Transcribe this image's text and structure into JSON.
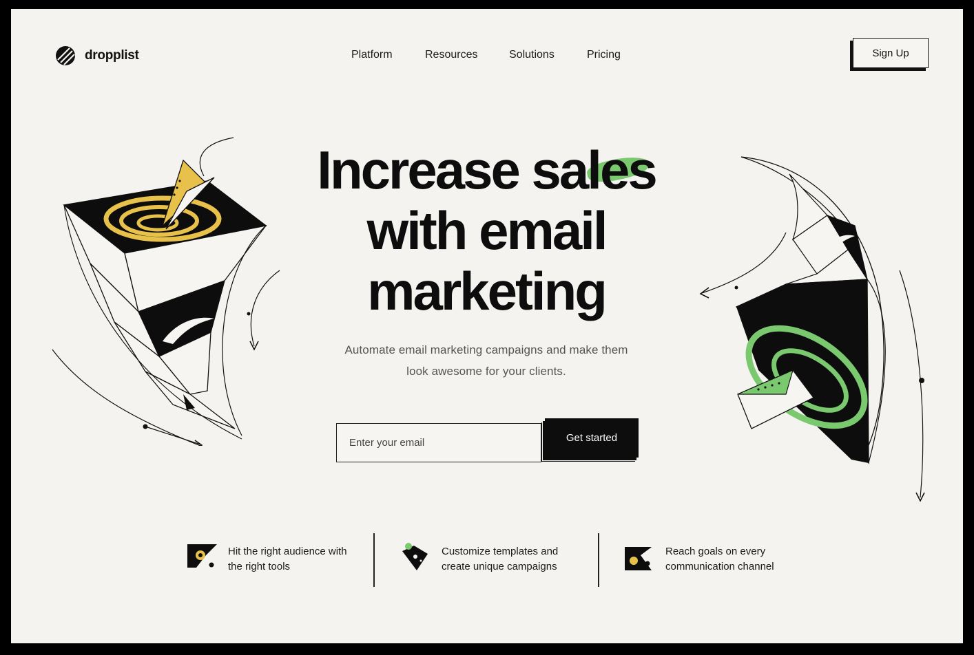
{
  "brand": {
    "name": "dropplist",
    "icon": "dropplist-logo-icon"
  },
  "nav": {
    "items": [
      {
        "label": "Platform"
      },
      {
        "label": "Resources"
      },
      {
        "label": "Solutions"
      },
      {
        "label": "Pricing"
      }
    ],
    "signup_label": "Sign Up"
  },
  "hero": {
    "line1_a": "Increase s",
    "line1_highlight": "ales",
    "line2": "with email",
    "line3": "marketing",
    "subtitle": "Automate email marketing campaigns and make them look awesome for your clients.",
    "email_placeholder": "Enter your email",
    "cta_label": "Get started"
  },
  "features": [
    {
      "icon": "target-audience-icon",
      "text": "Hit the right audience with the right tools"
    },
    {
      "icon": "template-shield-icon",
      "text": "Customize templates and create unique campaigns"
    },
    {
      "icon": "channel-flag-icon",
      "text": "Reach goals on every communication channel"
    }
  ],
  "colors": {
    "accent_green": "#7bc96f",
    "accent_yellow": "#e8c14a",
    "background": "#f4f3ef",
    "ink": "#0d0d0d"
  }
}
